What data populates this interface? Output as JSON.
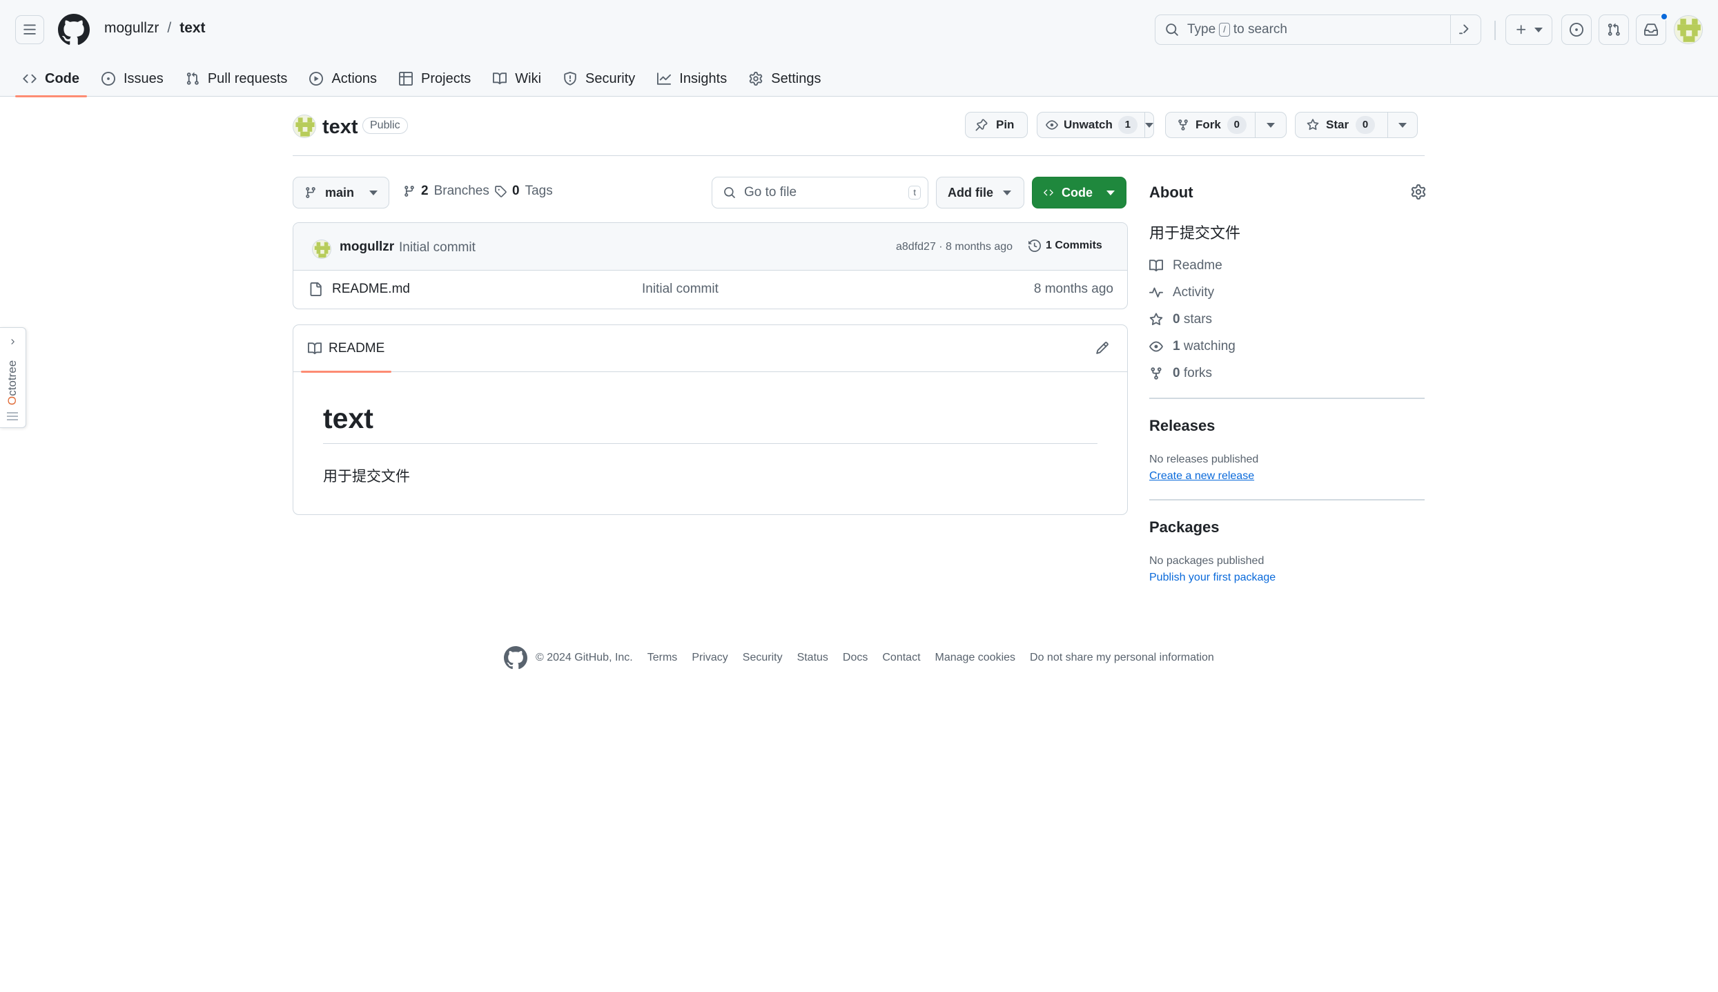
{
  "header": {
    "owner": "mogullzr",
    "separator": "/",
    "repo": "text",
    "search_prefix": "Type",
    "search_key": "/",
    "search_suffix": "to search"
  },
  "nav_tabs": [
    {
      "label": "Code",
      "icon": "code-icon",
      "active": true
    },
    {
      "label": "Issues",
      "icon": "issue-opened-icon"
    },
    {
      "label": "Pull requests",
      "icon": "git-pull-request-icon"
    },
    {
      "label": "Actions",
      "icon": "play-icon"
    },
    {
      "label": "Projects",
      "icon": "table-icon"
    },
    {
      "label": "Wiki",
      "icon": "book-icon"
    },
    {
      "label": "Security",
      "icon": "shield-icon"
    },
    {
      "label": "Insights",
      "icon": "graph-icon"
    },
    {
      "label": "Settings",
      "icon": "gear-icon"
    }
  ],
  "repo": {
    "name": "text",
    "visibility": "Public",
    "pin_label": "Pin",
    "unwatch_label": "Unwatch",
    "watch_count": "1",
    "fork_label": "Fork",
    "fork_count": "0",
    "star_label": "Star",
    "star_count": "0"
  },
  "file_nav": {
    "branch": "main",
    "branches_count": "2",
    "branches_label": "Branches",
    "tags_count": "0",
    "tags_label": "Tags",
    "goto_placeholder": "Go to file",
    "goto_key": "t",
    "add_file_label": "Add file",
    "code_label": "Code"
  },
  "commit": {
    "author": "mogullzr",
    "message": "Initial commit",
    "meta": "a8dfd27 · 8 months ago",
    "commits_label": "1 Commits"
  },
  "files": [
    {
      "name": "README.md",
      "commit": "Initial commit",
      "age": "8 months ago"
    }
  ],
  "readme": {
    "tab_label": "README",
    "heading": "text",
    "body": "用于提交文件"
  },
  "about": {
    "title": "About",
    "description": "用于提交文件",
    "readme": "Readme",
    "activity": "Activity",
    "stars_count": "0",
    "stars_label": "stars",
    "watching_count": "1",
    "watching_label": "watching",
    "forks_count": "0",
    "forks_label": "forks"
  },
  "releases": {
    "title": "Releases",
    "empty": "No releases published",
    "link": "Create a new release"
  },
  "packages": {
    "title": "Packages",
    "empty": "No packages published",
    "link": "Publish your first package"
  },
  "footer": {
    "copyright": "© 2024 GitHub, Inc.",
    "links": [
      "Terms",
      "Privacy",
      "Security",
      "Status",
      "Docs",
      "Contact",
      "Manage cookies",
      "Do not share my personal information"
    ]
  },
  "octotree": {
    "label_first": "O",
    "label_rest": "ctotree"
  },
  "colors": {
    "accent_underline": "#fd8c73",
    "code_button": "#1f883d",
    "link": "#0969da",
    "notification_dot": "#0969da"
  }
}
